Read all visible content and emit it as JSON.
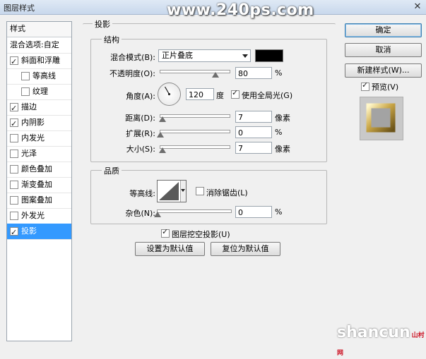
{
  "window": {
    "title": "图层样式",
    "close_glyph": "✕"
  },
  "watermark": "www.240ps.com",
  "logo": {
    "main": "shancun",
    "small": "山村网"
  },
  "styles_panel": {
    "header": "样式",
    "items": [
      {
        "label": "混合选项:自定",
        "checkbox": false,
        "checked": false,
        "indent": false,
        "selected": false
      },
      {
        "label": "斜面和浮雕",
        "checkbox": true,
        "checked": true,
        "indent": false,
        "selected": false
      },
      {
        "label": "等高线",
        "checkbox": true,
        "checked": false,
        "indent": true,
        "selected": false
      },
      {
        "label": "纹理",
        "checkbox": true,
        "checked": false,
        "indent": true,
        "selected": false
      },
      {
        "label": "描边",
        "checkbox": true,
        "checked": true,
        "indent": false,
        "selected": false
      },
      {
        "label": "内阴影",
        "checkbox": true,
        "checked": true,
        "indent": false,
        "selected": false
      },
      {
        "label": "内发光",
        "checkbox": true,
        "checked": false,
        "indent": false,
        "selected": false
      },
      {
        "label": "光泽",
        "checkbox": true,
        "checked": false,
        "indent": false,
        "selected": false
      },
      {
        "label": "颜色叠加",
        "checkbox": true,
        "checked": false,
        "indent": false,
        "selected": false
      },
      {
        "label": "渐变叠加",
        "checkbox": true,
        "checked": false,
        "indent": false,
        "selected": false
      },
      {
        "label": "图案叠加",
        "checkbox": true,
        "checked": false,
        "indent": false,
        "selected": false
      },
      {
        "label": "外发光",
        "checkbox": true,
        "checked": false,
        "indent": false,
        "selected": false
      },
      {
        "label": "投影",
        "checkbox": true,
        "checked": true,
        "indent": false,
        "selected": true
      }
    ]
  },
  "drop_shadow": {
    "section_title": "投影",
    "structure": {
      "title": "结构",
      "blend_mode": {
        "label": "混合模式(B):",
        "value": "正片叠底",
        "color": "#000000"
      },
      "opacity": {
        "label": "不透明度(O):",
        "value": "80",
        "unit": "%",
        "percent": 80
      },
      "angle": {
        "label": "角度(A):",
        "value": "120",
        "unit": "度",
        "degrees": 120,
        "global_light_label": "使用全局光(G)",
        "global_light_checked": true
      },
      "distance": {
        "label": "距离(D):",
        "value": "7",
        "unit": "像素",
        "percent": 3
      },
      "spread": {
        "label": "扩展(R):",
        "value": "0",
        "unit": "%",
        "percent": 0
      },
      "size": {
        "label": "大小(S):",
        "value": "7",
        "unit": "像素",
        "percent": 3
      }
    },
    "quality": {
      "title": "品质",
      "contour": {
        "label": "等高线:",
        "anti_alias_label": "消除锯齿(L)",
        "anti_alias_checked": false
      },
      "noise": {
        "label": "杂色(N):",
        "value": "0",
        "unit": "%",
        "percent": 0
      }
    },
    "knockout": {
      "label": "图层挖空投影(U)",
      "checked": true
    },
    "make_default_label": "设置为默认值",
    "reset_default_label": "复位为默认值"
  },
  "buttons": {
    "ok": "确定",
    "cancel": "取消",
    "new_style": "新建样式(W)..."
  },
  "preview": {
    "label": "预览(V)",
    "checked": true
  }
}
